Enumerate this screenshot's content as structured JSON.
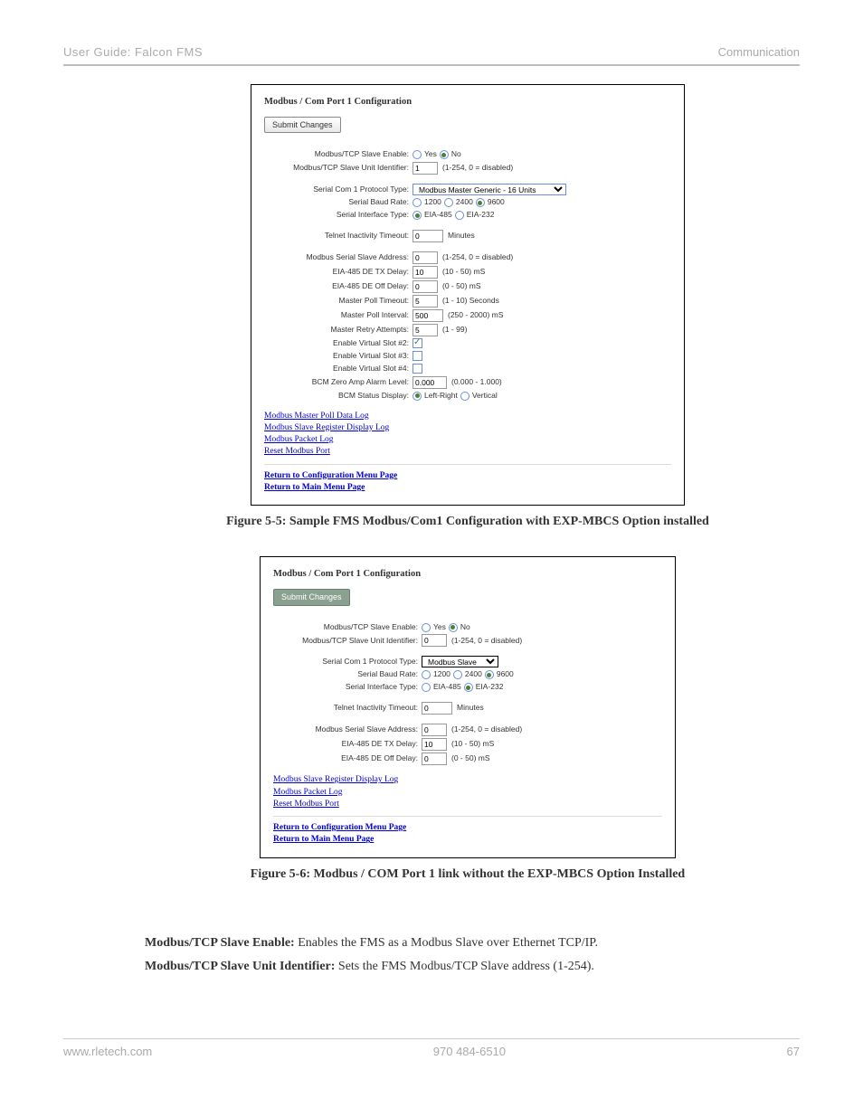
{
  "header": {
    "left": "User Guide: Falcon FMS",
    "right": "Communication"
  },
  "footer": {
    "left": "www.rletech.com",
    "center": "970 484-6510",
    "right": "67"
  },
  "fig1": {
    "title": "Modbus / Com Port 1 Configuration",
    "submit": "Submit Changes",
    "rows": {
      "slave_enable_label": "Modbus/TCP Slave Enable:",
      "slave_enable_yes": "Yes",
      "slave_enable_no": "No",
      "slave_unit_id_label": "Modbus/TCP Slave Unit Identifier:",
      "slave_unit_id_value": "1",
      "slave_unit_id_hint": "(1-254, 0 = disabled)",
      "protocol_type_label": "Serial Com 1 Protocol Type:",
      "protocol_type_value": "Modbus Master Generic - 16 Units",
      "baud_label": "Serial Baud Rate:",
      "baud_1200": "1200",
      "baud_2400": "2400",
      "baud_9600": "9600",
      "iface_label": "Serial Interface Type:",
      "iface_485": "EIA-485",
      "iface_232": "EIA-232",
      "telnet_label": "Telnet Inactivity Timeout:",
      "telnet_value": "0",
      "telnet_hint": "Minutes",
      "slave_addr_label": "Modbus Serial Slave Address:",
      "slave_addr_value": "0",
      "slave_addr_hint": "(1-254, 0 = disabled)",
      "tx_delay_label": "EIA-485 DE TX Delay:",
      "tx_delay_value": "10",
      "tx_delay_hint": "(10 - 50) mS",
      "off_delay_label": "EIA-485 DE Off Delay:",
      "off_delay_value": "0",
      "off_delay_hint": "(0 - 50) mS",
      "poll_to_label": "Master Poll Timeout:",
      "poll_to_value": "5",
      "poll_to_hint": "(1 - 10) Seconds",
      "poll_int_label": "Master Poll Interval:",
      "poll_int_value": "500",
      "poll_int_hint": "(250 - 2000) mS",
      "retry_label": "Master Retry Attempts:",
      "retry_value": "5",
      "retry_hint": "(1 - 99)",
      "vs2_label": "Enable Virtual Slot #2:",
      "vs3_label": "Enable Virtual Slot #3:",
      "vs4_label": "Enable Virtual Slot #4:",
      "bcm_zero_label": "BCM Zero Amp Alarm Level:",
      "bcm_zero_value": "0.000",
      "bcm_zero_hint": "(0.000 - 1.000)",
      "bcm_status_label": "BCM Status Display:",
      "bcm_lr": "Left-Right",
      "bcm_v": "Vertical"
    },
    "links": {
      "l1": "Modbus Master Poll Data Log",
      "l2": "Modbus Slave Register Display Log",
      "l3": "Modbus Packet Log",
      "l4": "Reset Modbus Port",
      "l5": "Return to Configuration Menu Page",
      "l6": "Return to Main Menu Page"
    },
    "caption": "Figure 5-5: Sample FMS Modbus/Com1 Configuration with EXP-MBCS Option installed"
  },
  "fig2": {
    "title": "Modbus / Com Port 1 Configuration",
    "submit": "Submit Changes",
    "rows": {
      "slave_enable_label": "Modbus/TCP Slave Enable:",
      "slave_enable_yes": "Yes",
      "slave_enable_no": "No",
      "slave_unit_id_label": "Modbus/TCP Slave Unit Identifier:",
      "slave_unit_id_value": "0",
      "slave_unit_id_hint": "(1-254, 0 = disabled)",
      "protocol_type_label": "Serial Com 1 Protocol Type:",
      "protocol_type_value": "Modbus Slave",
      "baud_label": "Serial Baud Rate:",
      "baud_1200": "1200",
      "baud_2400": "2400",
      "baud_9600": "9600",
      "iface_label": "Serial Interface Type:",
      "iface_485": "EIA-485",
      "iface_232": "EIA-232",
      "telnet_label": "Telnet Inactivity Timeout:",
      "telnet_value": "0",
      "telnet_hint": "Minutes",
      "slave_addr_label": "Modbus Serial Slave Address:",
      "slave_addr_value": "0",
      "slave_addr_hint": "(1-254, 0 = disabled)",
      "tx_delay_label": "EIA-485 DE TX Delay:",
      "tx_delay_value": "10",
      "tx_delay_hint": "(10 - 50) mS",
      "off_delay_label": "EIA-485 DE Off Delay:",
      "off_delay_value": "0",
      "off_delay_hint": "(0 - 50) mS"
    },
    "links": {
      "l1": "Modbus Slave Register Display Log",
      "l2": "Modbus Packet Log",
      "l3": "Reset Modbus Port",
      "l4": "Return to Configuration Menu Page",
      "l5": "Return to Main Menu Page"
    },
    "caption": "Figure 5-6: Modbus / COM Port 1 link without the EXP-MBCS Option Installed"
  },
  "paragraphs": {
    "p1_bold": "Modbus/TCP Slave Enable:",
    "p1_rest": " Enables the FMS as a Modbus Slave over Ethernet TCP/IP.",
    "p2_bold": "Modbus/TCP Slave Unit Identifier:",
    "p2_rest": " Sets the FMS Modbus/TCP Slave address (1-254)."
  }
}
